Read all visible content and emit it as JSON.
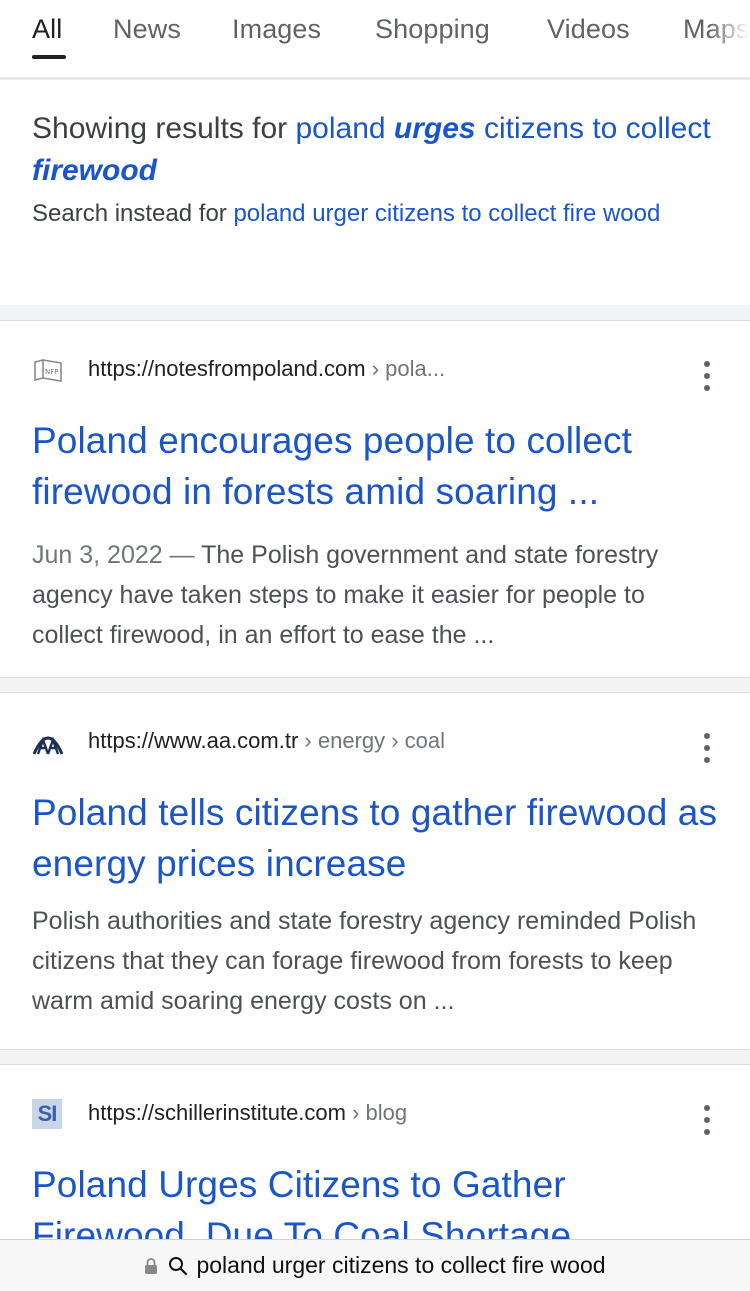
{
  "tabs": [
    {
      "label": "All",
      "active": true
    },
    {
      "label": "News"
    },
    {
      "label": "Images"
    },
    {
      "label": "Shopping"
    },
    {
      "label": "Videos"
    },
    {
      "label": "Maps"
    }
  ],
  "spelling": {
    "showing_prefix": "Showing results for",
    "corrected_parts": [
      "poland ",
      "urges",
      " citizens to collect ",
      "firewood"
    ],
    "instead_prefix": "Search instead for",
    "instead_query": "poland urger citizens to collect fire wood"
  },
  "results": [
    {
      "favicon": "nfp-logo-icon",
      "url": "https://notesfrompoland.com",
      "crumbs": " › pola...",
      "title": "Poland encourages people to collect firewood in forests amid soaring ...",
      "date": "Jun 3, 2022",
      "date_sep": " — ",
      "snippet": "The Polish government and state forestry agency have taken steps to make it easier for people to collect firewood, in an effort to ease the ..."
    },
    {
      "favicon": "aa-logo-icon",
      "url": "https://www.aa.com.tr",
      "crumbs": " › energy › coal",
      "title": "Poland tells citizens to gather firewood as energy prices increase",
      "date": "",
      "date_sep": "",
      "snippet": "Polish authorities and state forestry agency reminded Polish citizens that they can forage firewood from forests to keep warm amid soaring energy costs on ..."
    },
    {
      "favicon": "si-logo-icon",
      "favicon_text": "SI",
      "url": "https://schillerinstitute.com",
      "crumbs": " › blog",
      "title": "Poland Urges Citizens to Gather Firewood, Due To Coal Shortage"
    }
  ],
  "address_bar": {
    "text": "poland urger citizens to collect fire wood"
  },
  "colors": {
    "link": "#1a56c9",
    "background": "#f1f3f4"
  }
}
